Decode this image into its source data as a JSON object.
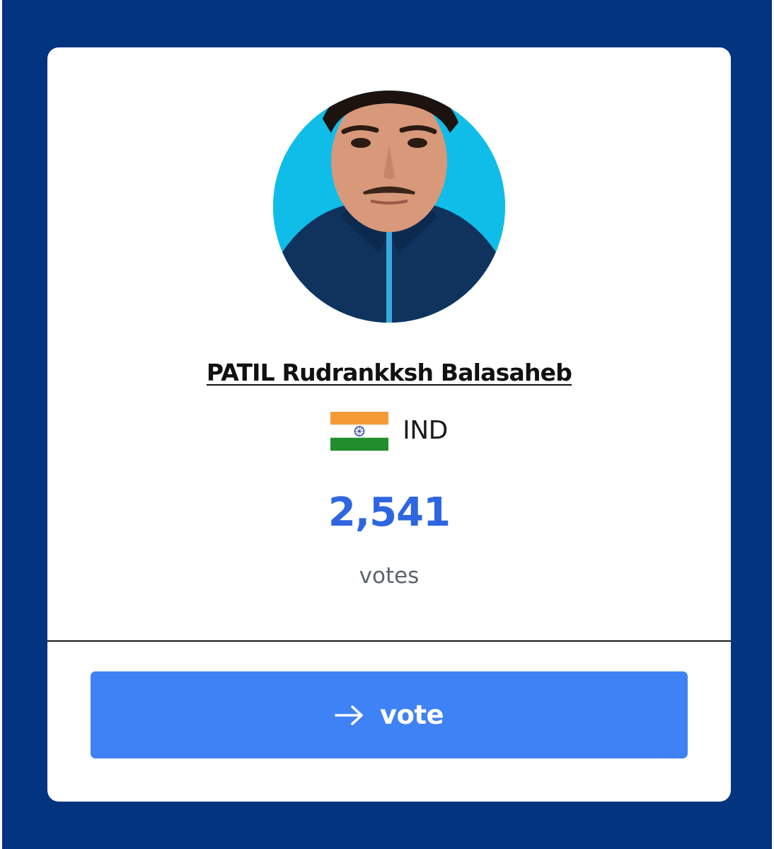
{
  "athlete": {
    "name": "PATIL Rudrankksh Balasaheb",
    "country_code": "IND",
    "flag_icon": "india-flag-icon",
    "photo": "athlete-photo-avatar"
  },
  "votes": {
    "count": "2,541",
    "label": "votes"
  },
  "action": {
    "icon": "arrow-right-icon",
    "vote_label": "vote"
  },
  "colors": {
    "frame_background": "#02347f",
    "card_background": "#ffffff",
    "vote_count": "#2f66e0",
    "button_background": "#3e82f5",
    "button_text": "#ffffff"
  }
}
